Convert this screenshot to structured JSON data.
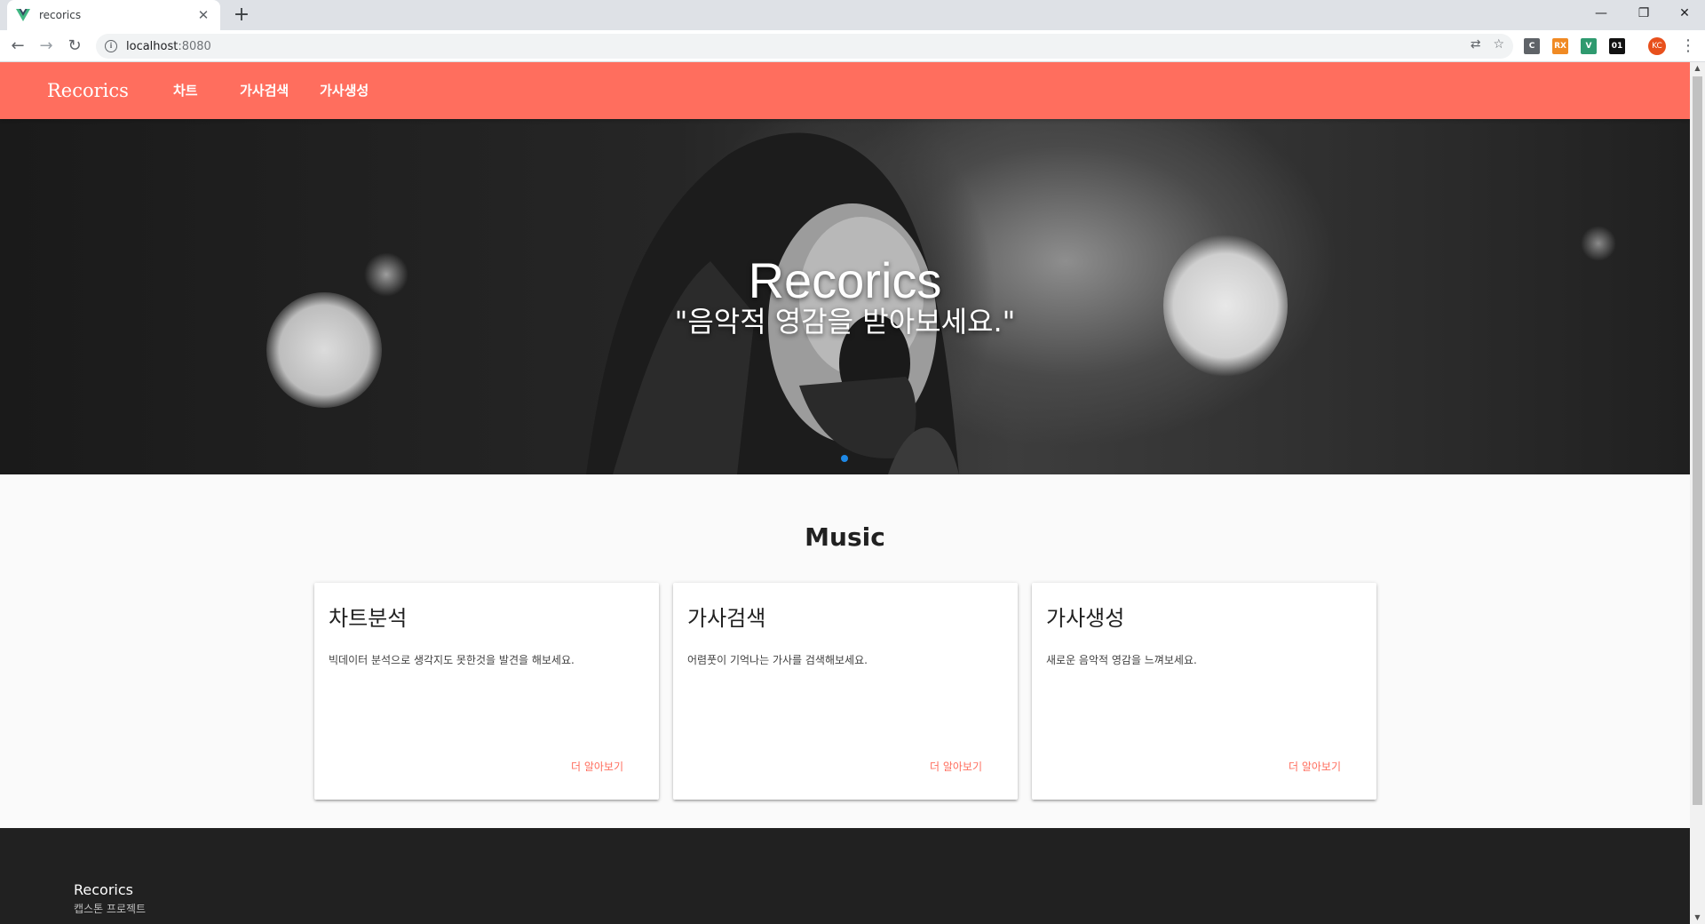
{
  "browser": {
    "tab_title": "recorics",
    "url_host": "localhost",
    "url_port": ":8080",
    "extensions": [
      {
        "name": "c-extension",
        "label": "C",
        "color": "#5f6368"
      },
      {
        "name": "rx-extension",
        "label": "RX",
        "color": "#f08a24"
      },
      {
        "name": "vue-devtools-extension",
        "label": "V",
        "color": "#2f9a6f"
      },
      {
        "name": "binary-extension",
        "label": "01",
        "color": "#111111"
      }
    ],
    "profile_initials": "KC"
  },
  "appbar": {
    "brand": "Recorics",
    "nav": [
      "차트",
      "가사검색",
      "가사생성"
    ],
    "color": "#ff6e5e"
  },
  "hero": {
    "title": "Recorics",
    "subtitle": "\"음악적 영감을 받아보세요.\""
  },
  "section": {
    "title": "Music"
  },
  "cards": [
    {
      "title": "차트분석",
      "text": "빅데이터 분석으로 생각지도 못한것을 발견을 해보세요.",
      "link": "더 알아보기"
    },
    {
      "title": "가사검색",
      "text": "어렴풋이 기억나는 가사를 검색해보세요.",
      "link": "더 알아보기"
    },
    {
      "title": "가사생성",
      "text": "새로운 음악적 영감을 느껴보세요.",
      "link": "더 알아보기"
    }
  ],
  "footer": {
    "brand": "Recorics",
    "subtitle": "캡스톤 프로젝트"
  }
}
